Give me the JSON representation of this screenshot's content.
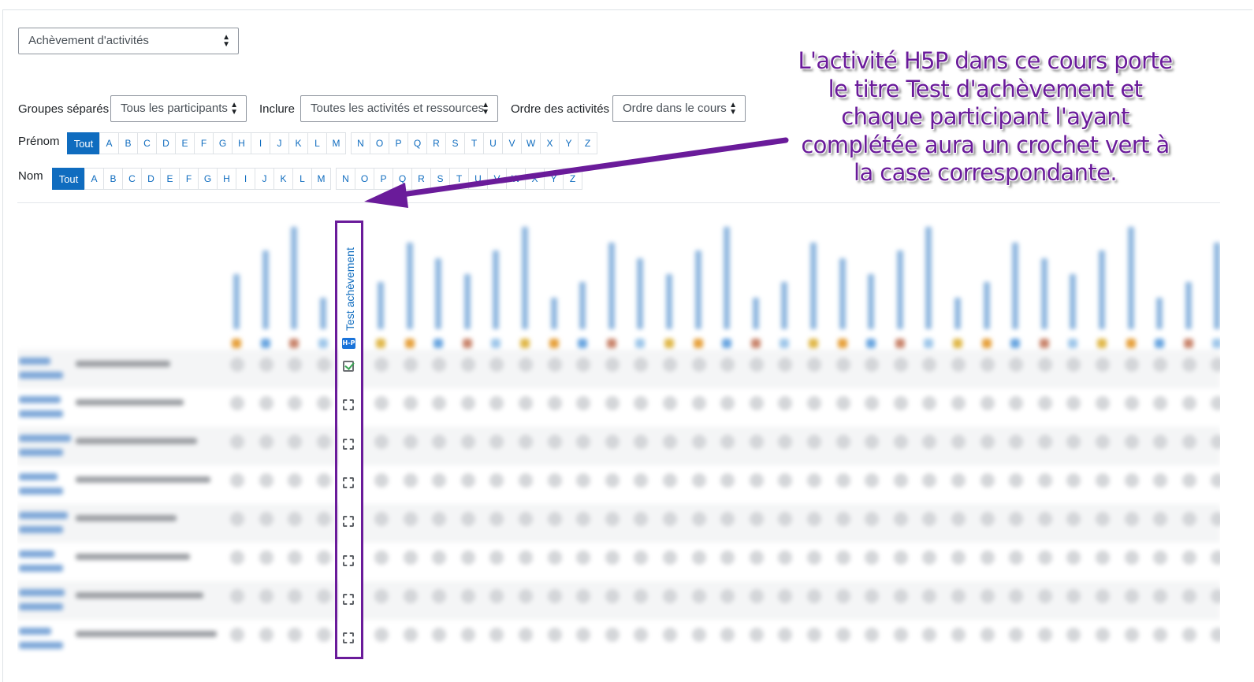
{
  "report_select": {
    "value": "Achèvement d'activités"
  },
  "filters": {
    "groups_label": "Groupes séparés",
    "groups_value": "Tous les participants",
    "include_label": "Inclure",
    "include_value": "Toutes les activités et ressources",
    "order_label": "Ordre des activités",
    "order_value": "Ordre dans le cours"
  },
  "firstname_filter": {
    "label": "Prénom",
    "all": "Tout",
    "letters": [
      "A",
      "B",
      "C",
      "D",
      "E",
      "F",
      "G",
      "H",
      "I",
      "J",
      "K",
      "L",
      "M",
      "N",
      "O",
      "P",
      "Q",
      "R",
      "S",
      "T",
      "U",
      "V",
      "W",
      "X",
      "Y",
      "Z"
    ]
  },
  "lastname_filter": {
    "label": "Nom",
    "all": "Tout",
    "letters": [
      "A",
      "B",
      "C",
      "D",
      "E",
      "F",
      "G",
      "H",
      "I",
      "J",
      "K",
      "L",
      "M",
      "N",
      "O",
      "P",
      "Q",
      "R",
      "S",
      "T",
      "U",
      "V",
      "W",
      "X",
      "Y",
      "Z"
    ]
  },
  "highlighted_activity": {
    "title": "Test achèvement",
    "icon": "H-P",
    "completion": [
      true,
      false,
      false,
      false,
      false,
      false,
      false,
      false
    ]
  },
  "annotation": {
    "text": "L'activité H5P dans ce cours porte le titre Test d'achèvement et chaque participant l'ayant complétée aura un crochet vert à la case correspondante."
  },
  "colors": {
    "accent": "#0f6cbf",
    "highlight": "#6a1b9a",
    "check": "#3aa655"
  }
}
